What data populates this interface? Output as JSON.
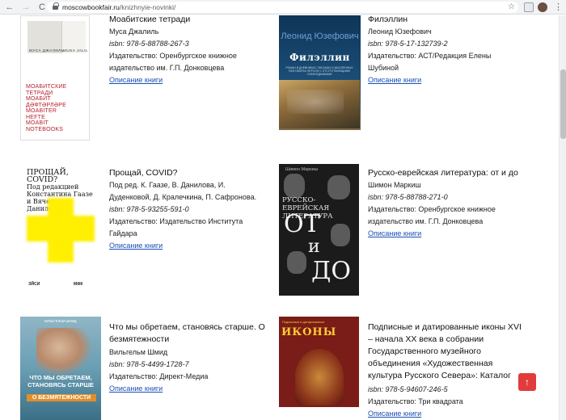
{
  "browser": {
    "url_host": "moscowbookfair.ru",
    "url_path": "/knizhnyie-novinki/",
    "back_glyph": "←",
    "forward_glyph": "→",
    "reload_glyph": "C",
    "star_glyph": "☆",
    "menu_glyph": "⋮"
  },
  "books": [
    {
      "title": "Моабитские тетради",
      "author": "Муса Джалиль",
      "isbn": "isbn: 978-5-88788-267-3",
      "publisher_lines": [
        "Издательство: Оренбургское книжное",
        "издательство им. Г.П. Донковцева"
      ],
      "link": "Описание книги",
      "cover": {
        "caption_left": "МУСА ДЖАЛИЛЬ",
        "caption_right": "MUSA JALIL",
        "red_lines": [
          "МОАБИТСКИЕ",
          "ТЕТРАДИ",
          "МОАБИТ",
          "ДӘФТӘРЛӘРЕ",
          "MOABITER",
          "HEFTE",
          "MOABIT",
          "NOTEBOOKS"
        ]
      }
    },
    {
      "title": "Филэллин",
      "author": "Леонид Юзефович",
      "isbn": "isbn: 978-5-17-132739-2",
      "publisher_lines": [
        "Издательство: АСТ/Редакция Елены",
        "Шубиной"
      ],
      "link": "Описание книги",
      "cover": {
        "author": "Леонид Юзефович",
        "name": "Филэллин",
        "subtitle": "РОМАН В ДНЕВНИКАХ, ПИСЬМАХ И МЫСЛЕННЫХ РАЗГОВОРАХ ПЕРСОН С ОТСУТСТВУЮЩИМИ СОБЕСЕДНИКАМИ"
      }
    },
    {
      "title": "Прощай, COVID?",
      "author_lines": [
        "Под ред. К. Гаазе, В. Данилова, И.",
        "Дуденковой, Д. Кралечкина, П. Сафронова."
      ],
      "isbn": "isbn: 978-5-93255-591-0",
      "publisher_lines": [
        "Издательство: Издательство Института",
        "Гайдара"
      ],
      "link": "Описание книги",
      "cover": {
        "title": "ПРОЩАЙ, COVID?",
        "editors": [
          "Под редакцией",
          "Константина Гаазе",
          "и Вячеслава Данилова"
        ],
        "logo_left": "ЭЙСИ",
        "logo_right": "МФК"
      }
    },
    {
      "title": "Русско-еврейская литература: от и до",
      "author": "Шимон Маркиш",
      "isbn": "isbn: 978-5-88788-271-0",
      "publisher_lines": [
        "Издательство: Оренбургское книжное",
        "издательство им. Г.П. Донковцева"
      ],
      "link": "Описание книги",
      "cover": {
        "author": "Шимон Маркиш",
        "subtitle": [
          "РУССКО-ЕВРЕЙСКАЯ",
          "ЛИТЕРАТУРА"
        ],
        "ot": "ОТ",
        "i": "и",
        "do": "ДО"
      }
    },
    {
      "title_lines": [
        "Что мы обретаем, становясь старше. О",
        "безмятежности"
      ],
      "author": "Вильгельм Шмид",
      "isbn": "isbn: 978-5-4499-1728-7",
      "publisher_lines": [
        "Издательство: Директ-Медиа"
      ],
      "link": "Описание книги",
      "cover": {
        "author": "ВИЛЬГЕЛЬМ ШМИД",
        "title_lines": [
          "ЧТО МЫ ОБРЕТАЕМ,",
          "СТАНОВЯСЬ СТАРШЕ"
        ],
        "subtitle": "О БЕЗМЯТЕЖНОСТИ"
      }
    },
    {
      "title_lines": [
        "Подписные и датированные иконы XVI",
        "– начала XX века в собрании",
        "Государственного музейного",
        "объединения «Художественная",
        "культура Русского Севера»: Каталог"
      ],
      "isbn": "isbn: 978-5-94607-246-5",
      "publisher_lines": [
        "Издательство: Три квадрата"
      ],
      "link": "Описание книги",
      "cover": {
        "top": "Подписные и датированные",
        "big": "ИКОНЫ"
      }
    }
  ],
  "scroll_top_glyph": "↑"
}
